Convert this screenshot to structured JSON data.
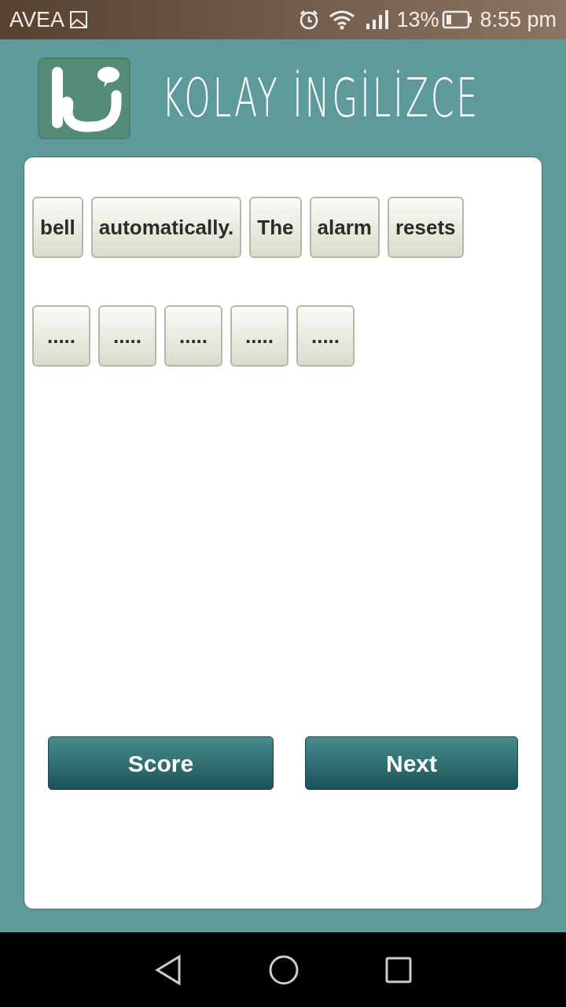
{
  "status_bar": {
    "carrier": "AVEA",
    "battery": "13%",
    "time": "8:55 pm"
  },
  "app_title": "KOLAY İNGİLİZCE",
  "words": [
    "bell",
    "automatically.",
    "The",
    "alarm",
    "resets"
  ],
  "blanks": [
    ".....",
    ".....",
    ".....",
    ".....",
    "....."
  ],
  "buttons": [
    "Score",
    "Next"
  ]
}
